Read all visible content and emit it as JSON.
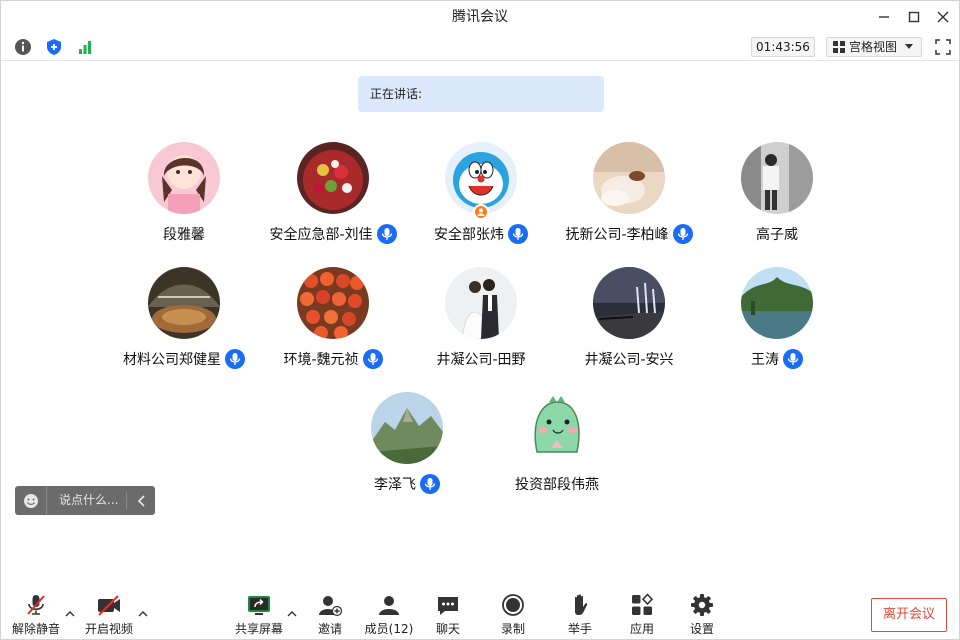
{
  "window": {
    "title": "腾讯会议"
  },
  "toolbar": {
    "timer": "01:43:56",
    "view_label": "宫格视图"
  },
  "speaking": {
    "label": "正在讲话:"
  },
  "participants": [
    {
      "name": "段雅馨",
      "mic": false
    },
    {
      "name": "安全应急部-刘佳",
      "mic": true
    },
    {
      "name": "安全部张炜",
      "mic": true,
      "host": true
    },
    {
      "name": "抚新公司-李柏峰",
      "mic": true
    },
    {
      "name": "高子威",
      "mic": false
    },
    {
      "name": "材料公司郑健星",
      "mic": true
    },
    {
      "name": "环境-魏元祯",
      "mic": true
    },
    {
      "name": "井凝公司-田野",
      "mic": false
    },
    {
      "name": "井凝公司-安兴",
      "mic": false
    },
    {
      "name": "王涛",
      "mic": true
    },
    {
      "name": "李泽飞",
      "mic": true
    },
    {
      "name": "投资部段伟燕",
      "mic": false
    }
  ],
  "chat": {
    "placeholder": "说点什么..."
  },
  "bottombar": {
    "unmute": "解除静音",
    "video": "开启视频",
    "share": "共享屏幕",
    "invite": "邀请",
    "members": "成员(12)",
    "chat": "聊天",
    "record": "录制",
    "raise_hand": "举手",
    "apps": "应用",
    "settings": "设置",
    "leave": "离开会议"
  },
  "colors": {
    "accent": "#1a6cf5",
    "leave": "#e0493d",
    "speaking_bg": "#dce8fb",
    "host_badge": "#ff7a1a"
  }
}
